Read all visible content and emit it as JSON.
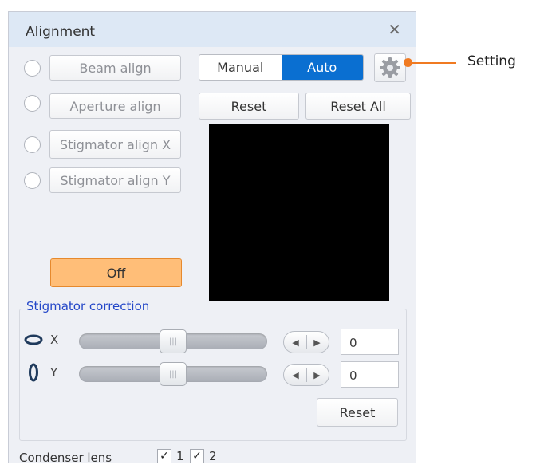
{
  "window": {
    "title": "Alignment",
    "close_glyph": "✕"
  },
  "align_options": [
    {
      "label": "Beam align"
    },
    {
      "label": "Aperture align"
    },
    {
      "label": "Stigmator align X"
    },
    {
      "label": "Stigmator align Y"
    }
  ],
  "mode": {
    "manual_label": "Manual",
    "auto_label": "Auto",
    "selected": "Auto"
  },
  "buttons": {
    "reset_label": "Reset",
    "reset_all_label": "Reset All",
    "off_label": "Off"
  },
  "stigmator": {
    "group_title": "Stigmator correction",
    "x": {
      "label": "X",
      "value": "0",
      "slider_level": 0.5
    },
    "y": {
      "label": "Y",
      "value": "0",
      "slider_level": 0.5
    },
    "reset_label": "Reset"
  },
  "condenser": {
    "label": "Condenser lens",
    "options": [
      {
        "label": "1",
        "checked": true
      },
      {
        "label": "2",
        "checked": true
      }
    ]
  },
  "callout": {
    "label": "Setting"
  },
  "colors": {
    "accent": "#0a6fd1",
    "off_button": "#ffbe78",
    "callout": "#f07a21",
    "group_title": "#2447c8"
  },
  "icons": {
    "settings": "gear-icon",
    "close": "close-icon",
    "step_left": "arrow-left-icon",
    "step_right": "arrow-right-icon"
  }
}
